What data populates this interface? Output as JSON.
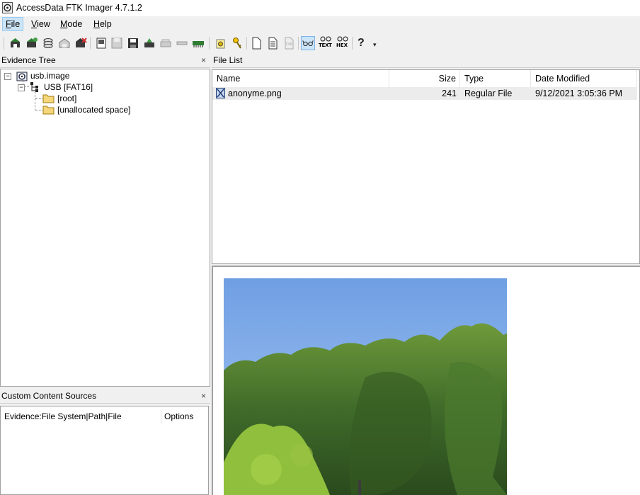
{
  "window": {
    "title": "AccessData FTK Imager 4.7.1.2"
  },
  "menu": [
    {
      "label": "File",
      "hotkey": "F",
      "rest": "ile"
    },
    {
      "label": "View",
      "hotkey": "V",
      "rest": "iew"
    },
    {
      "label": "Mode",
      "hotkey": "M",
      "rest": "ode"
    },
    {
      "label": "Help",
      "hotkey": "H",
      "rest": "elp"
    }
  ],
  "toolbar": {
    "text_btn": "TEXT",
    "hex_btn": "HEX",
    "help_glyph": "?",
    "overflow": "▾"
  },
  "evidence_tree": {
    "title": "Evidence Tree",
    "close": "×",
    "nodes": [
      {
        "label": "usb.image",
        "expander": "−"
      },
      {
        "label": "USB [FAT16]",
        "expander": "−"
      },
      {
        "label": "[root]"
      },
      {
        "label": "[unallocated space]"
      }
    ]
  },
  "file_list": {
    "title": "File List",
    "columns": [
      "Name",
      "Size",
      "Type",
      "Date Modified"
    ],
    "rows": [
      {
        "name": "anonyme.png",
        "size": "241",
        "type": "Regular File",
        "modified": "9/12/2021 3:05:36 PM"
      }
    ]
  },
  "custom_sources": {
    "title": "Custom Content Sources",
    "close": "×",
    "columns": [
      "Evidence:File System|Path|File",
      "Options"
    ]
  },
  "colors": {
    "selection": "#cce4f7",
    "folder": "#f5d77a",
    "sky_top": "#6f9fe3",
    "sky_bottom": "#a9c9f3",
    "foliage": "#3f6b2a"
  }
}
